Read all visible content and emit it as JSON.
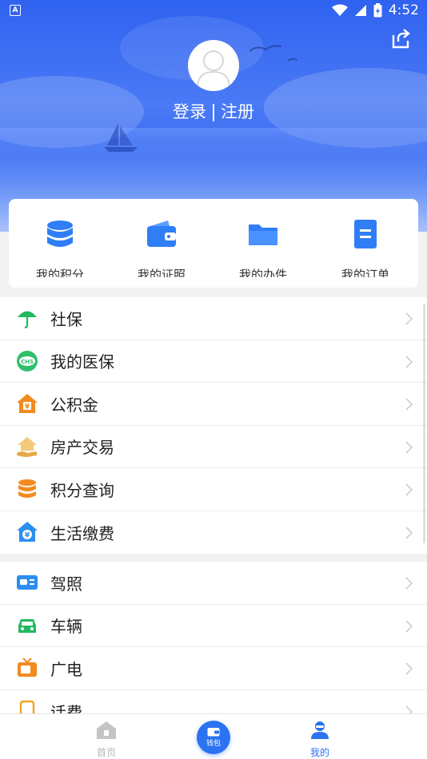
{
  "status_bar": {
    "notification_glyph": "A",
    "time": "4:52"
  },
  "header": {
    "login_label": "登录",
    "register_label": "注册"
  },
  "quick_actions": [
    {
      "label": "我的积分",
      "icon": "database-icon",
      "color": "#2f7ef5"
    },
    {
      "label": "我的证照",
      "icon": "wallet-icon",
      "color": "#2f7ef5"
    },
    {
      "label": "我的办件",
      "icon": "folder-icon",
      "color": "#2f7ef5"
    },
    {
      "label": "我的订单",
      "icon": "document-icon",
      "color": "#2f7ef5"
    }
  ],
  "list_one": [
    {
      "label": "社保",
      "icon": "umbrella-icon"
    },
    {
      "label": "我的医保",
      "icon": "chs-badge-icon"
    },
    {
      "label": "公积金",
      "icon": "house-yuan-icon"
    },
    {
      "label": "房产交易",
      "icon": "house-hand-icon"
    },
    {
      "label": "积分查询",
      "icon": "coins-stack-icon"
    },
    {
      "label": "生活缴费",
      "icon": "home-yuan-icon"
    }
  ],
  "list_two": [
    {
      "label": "驾照",
      "icon": "license-card-icon"
    },
    {
      "label": "车辆",
      "icon": "car-icon"
    },
    {
      "label": "广电",
      "icon": "tv-icon"
    },
    {
      "label": "话费",
      "icon": "phone-icon"
    }
  ],
  "bottom_nav": {
    "home_label": "首页",
    "wallet_label": "钱包",
    "mine_label": "我的"
  },
  "colors": {
    "accent": "#2b73f0",
    "header_top": "#2f62f0",
    "nav_inactive": "#b5b5b5"
  }
}
